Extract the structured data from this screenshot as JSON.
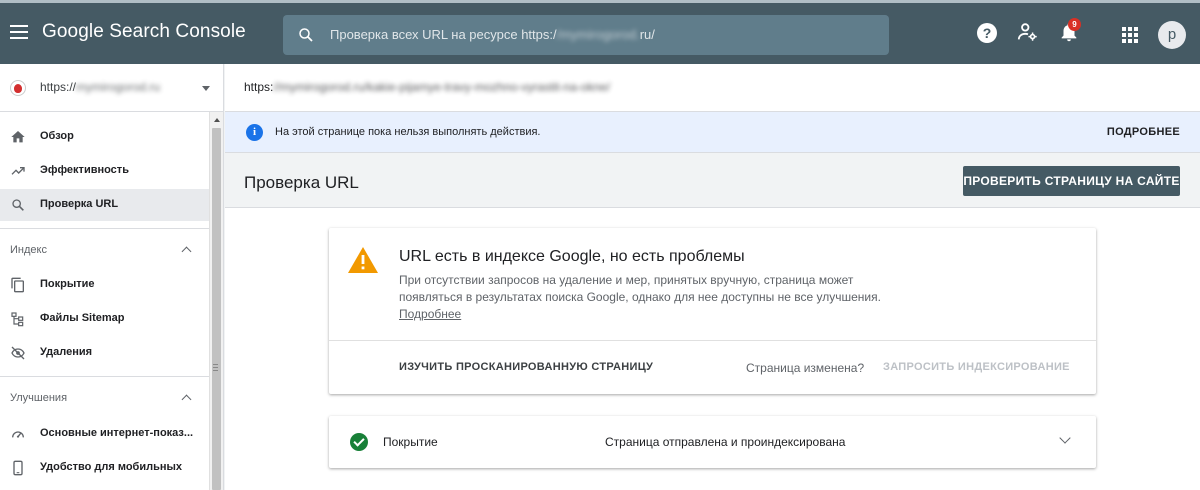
{
  "header": {
    "app_title": "Google Search Console",
    "search_placeholder_prefix": "Проверка всех URL на ресурсе https:/",
    "search_placeholder_hidden": "/mymirogorod.",
    "search_placeholder_suffix": "ru/",
    "notifications_count": "9",
    "avatar_letter": "p"
  },
  "sidebar": {
    "property_prefix": "https://",
    "property_hidden": "mymirogorod.ru",
    "items_top": [
      {
        "label": "Обзор",
        "icon": "home-icon"
      },
      {
        "label": "Эффективность",
        "icon": "trending-up-icon"
      },
      {
        "label": "Проверка URL",
        "icon": "search-icon"
      }
    ],
    "section_index": "Индекс",
    "items_index": [
      {
        "label": "Покрытие",
        "icon": "file-copy-icon"
      },
      {
        "label": "Файлы Sitemap",
        "icon": "sitemap-icon"
      },
      {
        "label": "Удаления",
        "icon": "visibility-off-icon"
      }
    ],
    "section_improvements": "Улучшения",
    "items_improvements": [
      {
        "label": "Основные интернет-показ...",
        "icon": "speed-gauge-icon"
      },
      {
        "label": "Удобство для мобильных",
        "icon": "smartphone-icon"
      }
    ]
  },
  "url_bar": {
    "prefix": "https:",
    "hidden": "//mymirogorod.ru/kakie-pijamye-travy-mozhno-vyrastit-na-okne/"
  },
  "info_bar": {
    "text": "На этой странице пока нельзя выполнять действия.",
    "more_label": "ПОДРОБНЕЕ"
  },
  "page": {
    "title": "Проверка URL",
    "check_live_button": "ПРОВЕРИТЬ СТРАНИЦУ НА САЙТЕ"
  },
  "status_card": {
    "title": "URL есть в индексе Google, но есть проблемы",
    "description": "При отсутствии запросов на удаление и мер, принятых вручную, страница может появляться в результатах поиска Google, однако для нее доступны не все улучшения.",
    "learn_more": "Подробнее",
    "explore_button": "ИЗУЧИТЬ ПРОСКАНИРОВАННУЮ СТРАНИЦУ",
    "page_changed": "Страница изменена?",
    "request_indexing": "ЗАПРОСИТЬ ИНДЕКСИРОВАНИЕ"
  },
  "coverage_card": {
    "label": "Покрытие",
    "value": "Страница отправлена и проиндексирована"
  },
  "colors": {
    "topbar": "#455a64",
    "warning": "#f29900",
    "success": "#188038",
    "info": "#1a73e8"
  }
}
